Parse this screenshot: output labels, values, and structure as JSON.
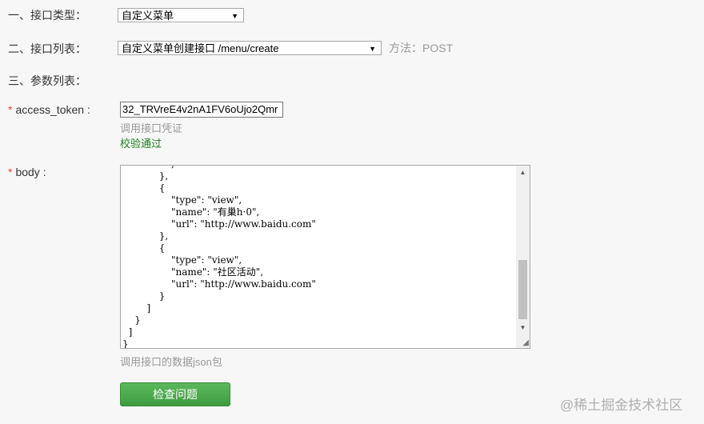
{
  "fields": {
    "interface_type_label": "一、接口类型：",
    "interface_type_value": "自定义菜单",
    "interface_list_label": "二、接口列表：",
    "interface_list_value": "自定义菜单创建接口 /menu/create",
    "method_text": "方法：POST",
    "params_label": "三、参数列表：",
    "access_token_label": "access_token :",
    "access_token_value": "32_TRVreE4v2nA1FV6oUjo2Qmr",
    "access_token_hint": "调用接口凭证",
    "access_token_status": "校验通过",
    "body_label": "body :",
    "body_code": "                ,\n            },\n            {\n                \"type\": \"view\",\n                \"name\": \"有巢h·0\",\n                \"url\": \"http://www.baidu.com\"\n            },\n            {\n                \"type\": \"view\",\n                \"name\": \"社区活动\",\n                \"url\": \"http://www.baidu.com\"\n            }\n        ]\n    }\n  ]\n}",
    "body_hint": "调用接口的数据json包",
    "required_mark": "*"
  },
  "buttons": {
    "check_label": "检查问题"
  },
  "watermark": "@稀土掘金技术社区",
  "icons": {
    "dropdown_arrow": "▼",
    "scroll_up": "▲",
    "scroll_down": "▼",
    "resize_grip": "◢"
  },
  "colors": {
    "required": "#e64340",
    "success": "#1a7f1a",
    "button": "#4cae4c"
  }
}
